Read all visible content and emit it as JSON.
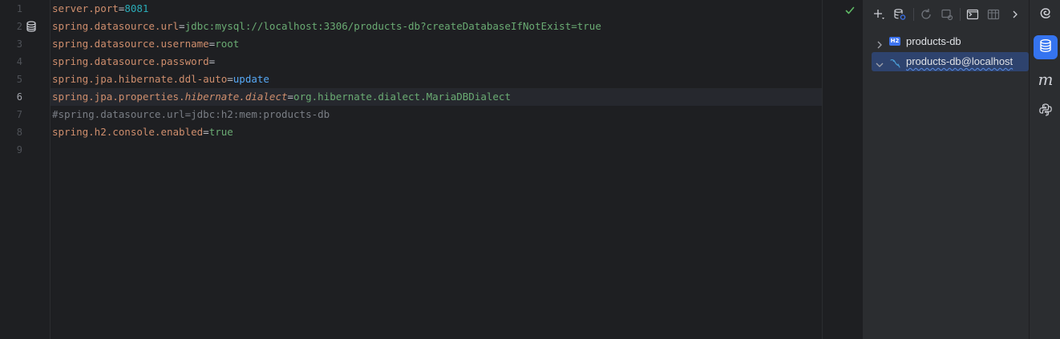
{
  "editor": {
    "line_numbers": [
      "1",
      "2",
      "3",
      "4",
      "5",
      "6",
      "7",
      "8",
      "9"
    ],
    "current_line": "6",
    "lines": [
      {
        "key": "server.port",
        "eq": "=",
        "value": "8081"
      },
      {
        "key": "spring.datasource.url",
        "eq": "=",
        "value": "jdbc:mysql://localhost:3306/products-db?createDatabaseIfNotExist=true"
      },
      {
        "key": "spring.datasource.username",
        "eq": "=",
        "value": "root"
      },
      {
        "key": "spring.datasource.password",
        "eq": "="
      },
      {
        "key": "spring.jpa.hibernate.ddl-auto",
        "eq": "=",
        "value": "update"
      },
      {
        "key_prefix": "spring.jpa.properties.",
        "key_italic": "hibernate.dialect",
        "eq": "=",
        "value": "org.hibernate.dialect.MariaDBDialect"
      },
      {
        "comment": "#spring.datasource.url=jdbc:h2:mem:products-db"
      },
      {
        "key": "spring.h2.console.enabled",
        "eq": "=",
        "value": "true"
      }
    ],
    "gutter_icon": "database-icon",
    "status_icon": "checkmark-icon",
    "colors": {
      "key": "#cf8e6d",
      "string_value": "#6aab73",
      "number_value": "#2aacb8",
      "keyword_value": "#56a8f5",
      "comment": "#7a7e85"
    }
  },
  "db_panel": {
    "toolbar_icons": [
      "add-icon",
      "data-source-properties-icon",
      "refresh-icon",
      "disconnect-icon",
      "query-console-icon",
      "table-view-icon",
      "more-chevron-icon"
    ],
    "tree": [
      {
        "label": "products-db",
        "icon": "h2-badge-icon",
        "badge": "H2",
        "expanded": false
      },
      {
        "label": "products-db@localhost",
        "icon": "mysql-dolphin-icon",
        "expanded": true,
        "selected": true
      }
    ],
    "colors": {
      "selection": "#2e436e",
      "h2_badge": "#3d74f0"
    }
  },
  "tool_strip": {
    "buttons": [
      {
        "icon": "ai-assistant-spiral-icon",
        "active": false
      },
      {
        "icon": "database-icon",
        "active": true
      },
      {
        "icon": "maven-m-icon",
        "glyph": "m",
        "active": false
      },
      {
        "icon": "python-console-icon",
        "active": false
      }
    ],
    "accent": "#3574f0"
  }
}
